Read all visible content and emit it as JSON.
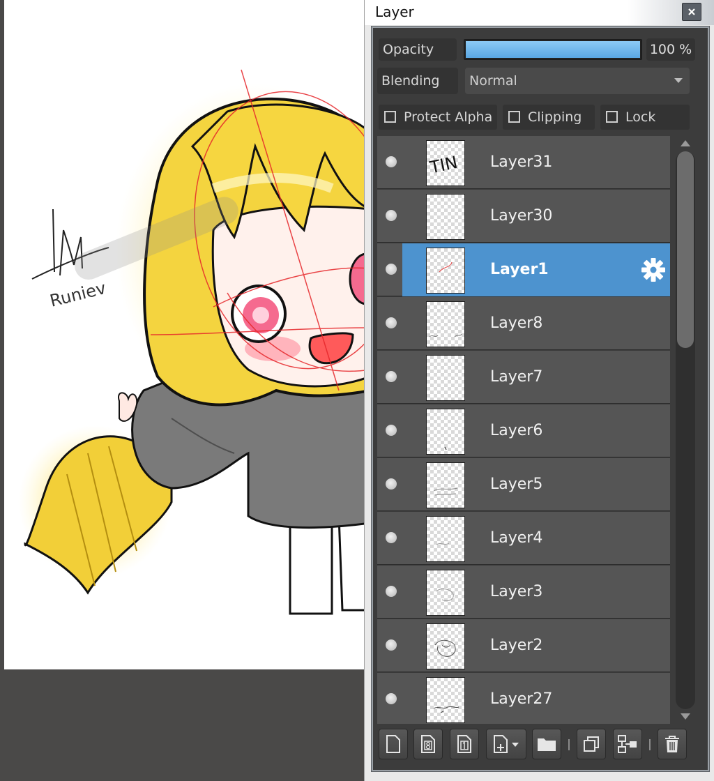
{
  "panel": {
    "title": "Layer",
    "opacity_label": "Opacity",
    "opacity_percent": 100,
    "opacity_value": "100 %",
    "blending_label": "Blending",
    "blending_value": "Normal",
    "checks": {
      "protect_alpha": "Protect Alpha",
      "clipping": "Clipping",
      "lock": "Lock"
    }
  },
  "layers": [
    {
      "name": "Layer31",
      "selected": false
    },
    {
      "name": "Layer30",
      "selected": false
    },
    {
      "name": "Layer1",
      "selected": true
    },
    {
      "name": "Layer8",
      "selected": false
    },
    {
      "name": "Layer7",
      "selected": false
    },
    {
      "name": "Layer6",
      "selected": false
    },
    {
      "name": "Layer5",
      "selected": false
    },
    {
      "name": "Layer4",
      "selected": false
    },
    {
      "name": "Layer3",
      "selected": false
    },
    {
      "name": "Layer2",
      "selected": false
    },
    {
      "name": "Layer27",
      "selected": false
    }
  ],
  "thumbnail_text": {
    "layer31": "TIN"
  },
  "artwork": {
    "signature_text": "Runiev"
  },
  "toolbar": {
    "icons": [
      "new-layer-icon",
      "new-8bit-layer-icon",
      "new-1bit-layer-icon",
      "add-layer-menu-icon",
      "folder-icon",
      "duplicate-layer-icon",
      "merge-down-icon",
      "delete-layer-icon"
    ]
  },
  "colors": {
    "selected_row": "#4d93cf",
    "panel_bg": "#3c3c3c",
    "row_bg": "#555555",
    "opacity_fill": "#6bb4ec",
    "hair": "#f4d43f",
    "hoodie": "#7a7a7a"
  }
}
